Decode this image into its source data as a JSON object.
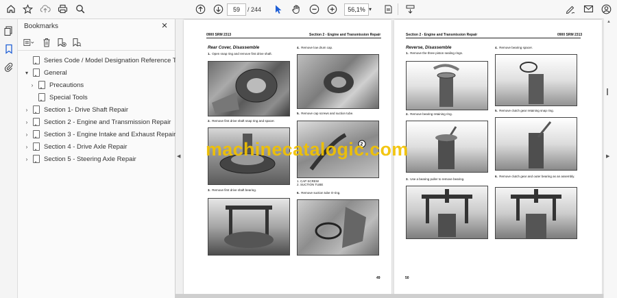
{
  "toolbar": {
    "page_current": "59",
    "page_total": "/  244",
    "zoom": "56,1%",
    "zoom_dropdown": "▾"
  },
  "bookmarks": {
    "title": "Bookmarks",
    "close": "×",
    "items": [
      {
        "label": "Series Code / Model Designation Reference Table",
        "chevron": ""
      },
      {
        "label": "General",
        "chevron": "▾"
      },
      {
        "label": "Precautions",
        "chevron": "›"
      },
      {
        "label": "Special Tools",
        "chevron": ""
      },
      {
        "label": "Section 1- Drive Shaft Repair",
        "chevron": "›"
      },
      {
        "label": "Section 2 - Engine and Transmission Repair",
        "chevron": "›"
      },
      {
        "label": "Section 3 - Engine Intake and Exhaust Repair",
        "chevron": "›"
      },
      {
        "label": "Section 4 - Drive Axle Repair",
        "chevron": "›"
      },
      {
        "label": "Section 5 - Steering Axle Repair",
        "chevron": "›"
      }
    ]
  },
  "page_left": {
    "header_left": "0900 SRM 2313",
    "header_right": "Section 2 - Engine and Transmission Repair",
    "section_title": "Rear Cover, Disassemble",
    "steps": [
      {
        "num": "1.",
        "text": "Open snap ring and remove first drive shaft."
      },
      {
        "num": "2.",
        "text": "Remove first drive shaft snap ring and spacer."
      },
      {
        "num": "3.",
        "text": "Remove first drive shaft bearing."
      },
      {
        "num": "4.",
        "text": "Remove low drum cap."
      },
      {
        "num": "5.",
        "text": "Remove cap screws and suction tube."
      },
      {
        "num": "6.",
        "text": "Remove suction tube O-ring."
      }
    ],
    "legend_1": "1.   CAP SCREW",
    "legend_2": "2.   SUCTION TUBE",
    "callout": "2",
    "page_number": "49"
  },
  "page_right": {
    "header_left": "Section 2 - Engine and Transmission Repair",
    "header_right": "0900 SRM 2313",
    "section_title": "Reverse, Disassemble",
    "steps": [
      {
        "num": "1.",
        "text": "Remove the three piston sealing rings."
      },
      {
        "num": "2.",
        "text": "Remove bearing retaining ring."
      },
      {
        "num": "3.",
        "text": "Use a bearing puller to remove bearing."
      },
      {
        "num": "4.",
        "text": "Remove bearing spacer."
      },
      {
        "num": "5.",
        "text": "Remove clutch gear retaining snap ring."
      },
      {
        "num": "6.",
        "text": "Remove clutch gear and outer bearing as an assembly."
      }
    ],
    "page_number": "50"
  },
  "watermark": "machinecatalogic.com"
}
